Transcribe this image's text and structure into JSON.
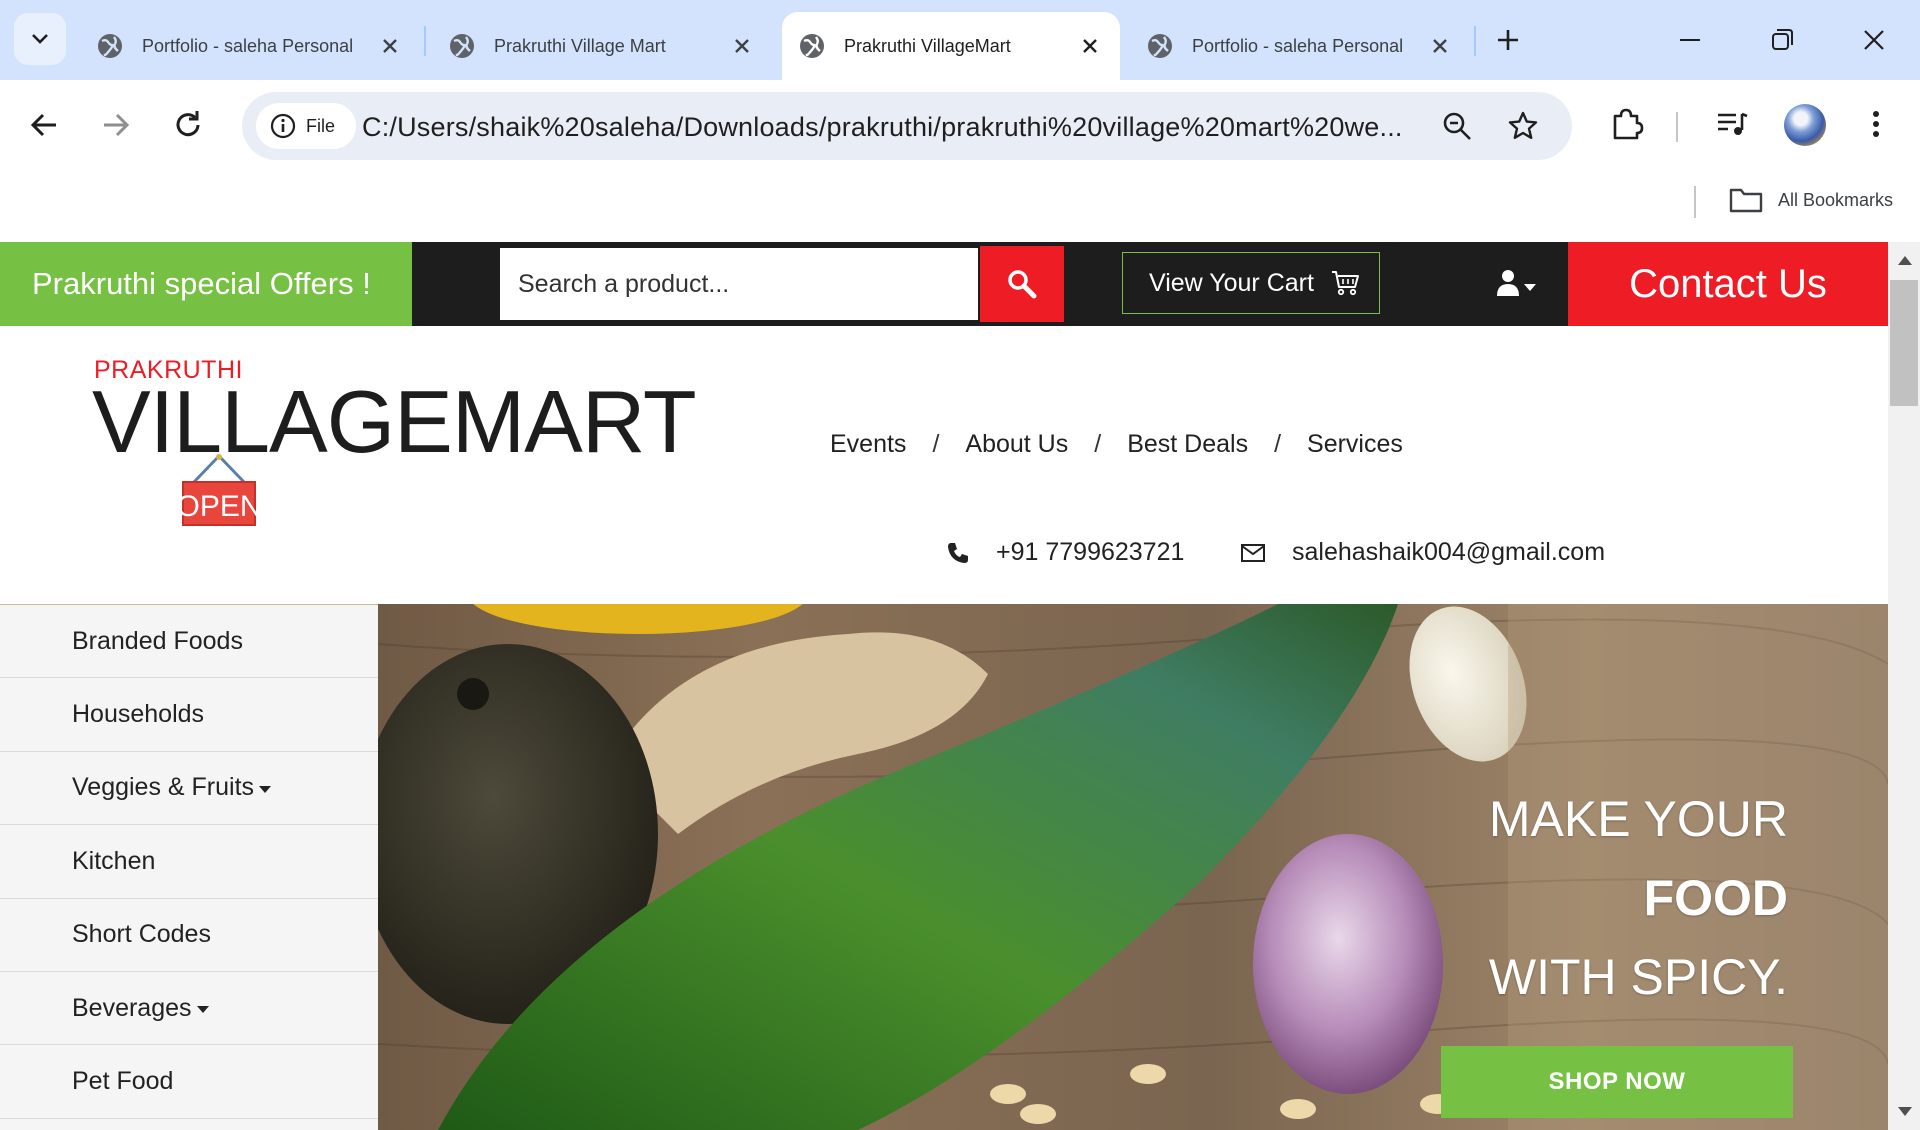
{
  "browser": {
    "tabs": [
      {
        "title": "Portfolio - saleha Personal",
        "active": false
      },
      {
        "title": "Prakruthi Village Mart",
        "active": false
      },
      {
        "title": "Prakruthi VillageMart",
        "active": true
      },
      {
        "title": "Portfolio - saleha Personal",
        "active": false
      }
    ],
    "url_chip": "File",
    "url": "C:/Users/shaik%20saleha/Downloads/prakruthi/prakruthi%20village%20mart%20we...",
    "all_bookmarks": "All Bookmarks"
  },
  "topbar": {
    "offers": "Prakruthi special Offers !",
    "search_placeholder": "Search a product...",
    "cart": "View Your Cart",
    "contact": "Contact Us"
  },
  "header": {
    "brand_small": "PRAKRUTHI",
    "brand_big": "VILLAGEMART",
    "sign_text": "OPEN",
    "nav": [
      "Events",
      "About Us",
      "Best Deals",
      "Services"
    ],
    "nav_separator": "/",
    "phone": "+91 7799623721",
    "email": "salehashaik004@gmail.com"
  },
  "sidebar": {
    "categories": [
      {
        "label": "Branded Foods",
        "dropdown": false
      },
      {
        "label": "Households",
        "dropdown": false
      },
      {
        "label": "Veggies & Fruits",
        "dropdown": true
      },
      {
        "label": "Kitchen",
        "dropdown": false
      },
      {
        "label": "Short Codes",
        "dropdown": false
      },
      {
        "label": "Beverages",
        "dropdown": true
      },
      {
        "label": "Pet Food",
        "dropdown": false
      }
    ]
  },
  "hero": {
    "line1": "MAKE YOUR",
    "line2": "FOOD",
    "line3": "WITH SPICY.",
    "button": "SHOP NOW"
  },
  "colors": {
    "green": "#76c043",
    "red": "#ee1c25",
    "dark": "#1d1d1d",
    "chrome_tabstrip": "#d3e3fd"
  }
}
